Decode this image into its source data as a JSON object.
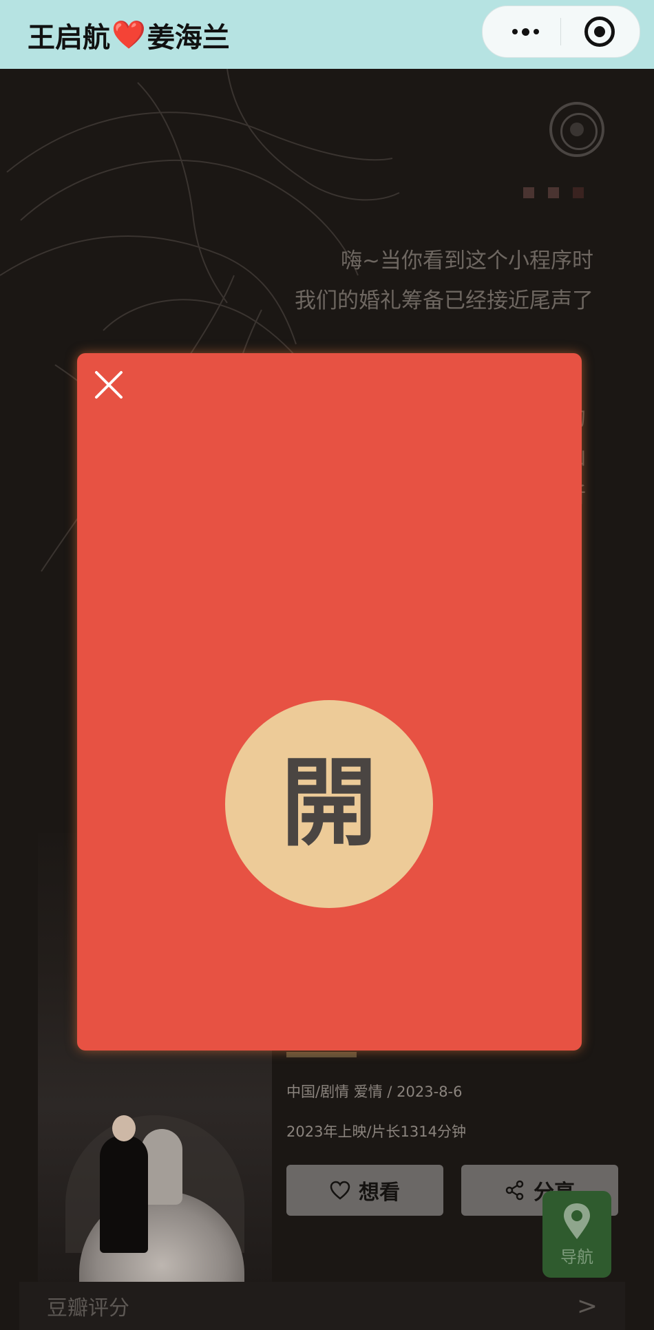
{
  "header": {
    "title_left": "王启航",
    "heart": "❤️",
    "title_right": "姜海兰"
  },
  "intro": {
    "line1": "嗨~当你看到这个小程序时",
    "line2": "我们的婚礼筹备已经接近尾声了",
    "clipped": [
      "的",
      "函",
      "昕"
    ]
  },
  "carousel_dots_colors": [
    "#4a3431",
    "#4a3431",
    "#3a2320"
  ],
  "movie": {
    "meta_line1": "中国/剧情 爱情 / 2023-8-6",
    "meta_line2": "2023年上映/片长1314分钟"
  },
  "actions": {
    "want_label": "想看",
    "share_label": "分享"
  },
  "nav": {
    "label": "导航"
  },
  "rating": {
    "label": "豆瓣评分",
    "chevron": ">"
  },
  "envelope": {
    "open_label": "開",
    "colors": {
      "envelope": "#e75243",
      "button": "#edcb98"
    }
  }
}
